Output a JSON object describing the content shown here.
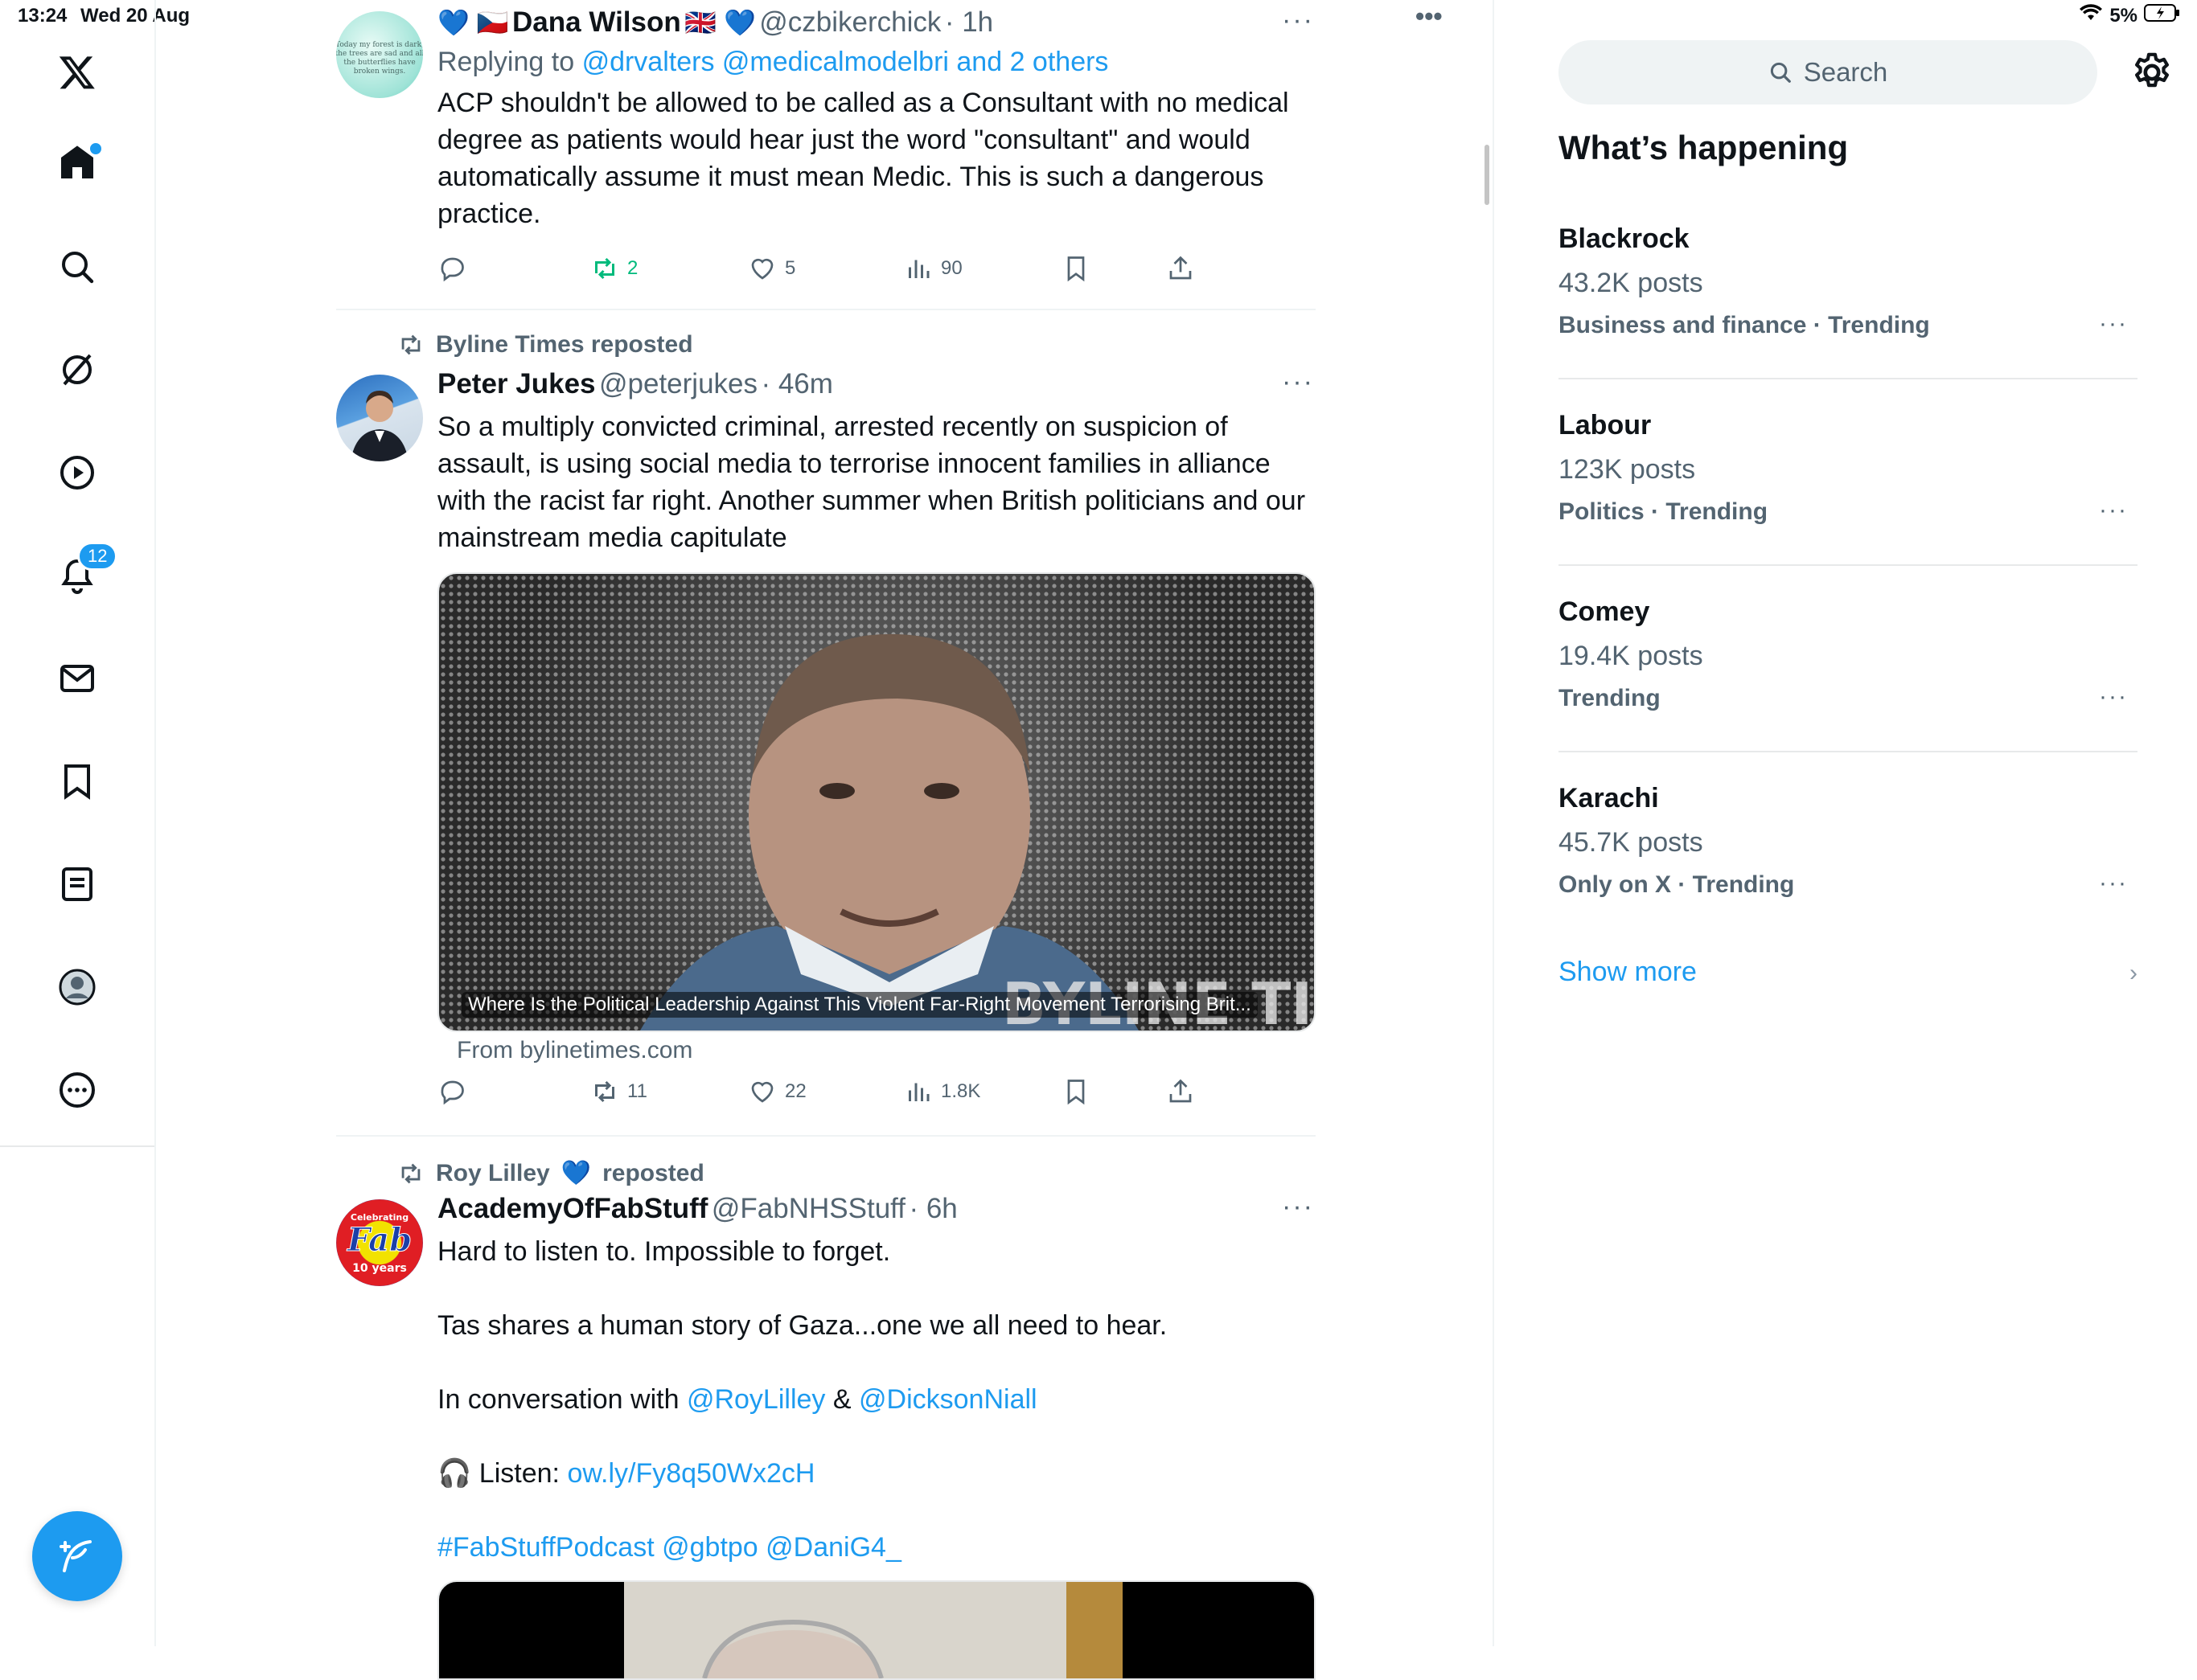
{
  "status_bar": {
    "time": "13:24",
    "date": "Wed 20 Aug",
    "battery": "5%"
  },
  "nav": {
    "notifications_badge": "12"
  },
  "feed": {
    "tweet1": {
      "name_prefix_emoji": "💙 🇨🇿",
      "name": "Dana Wilson",
      "name_suffix_emoji": "🇬🇧 💙",
      "handle": "@czbikerchick",
      "time": "· 1h",
      "top_more": "•••",
      "more": "···",
      "replying_to_label": "Replying to",
      "replying_to_users": "@drvalters @medicalmodelbri and 2 others",
      "text": "ACP shouldn't be allowed to be called as a Consultant with no medical degree as patients would hear just the word \"consultant\" and would automatically assume it must mean Medic. This is such a dangerous practice.",
      "reposts": "2",
      "likes": "5",
      "views": "90"
    },
    "tweet2": {
      "repost_by": "Byline Times reposted",
      "name": "Peter Jukes",
      "handle": "@peterjukes",
      "time": "· 46m",
      "more": "···",
      "text": "So a multiply convicted criminal, arrested recently on suspicion of assault, is using social media to terrorise innocent families in alliance with the racist far right. Another summer when British politicians and our mainstream media capitulate",
      "card_caption": "Where Is the Political Leadership Against This Violent Far-Right Movement Terrorising Brit...",
      "card_source": "From bylinetimes.com",
      "reposts": "11",
      "likes": "22",
      "views": "1.8K"
    },
    "tweet3": {
      "repost_by_name": "Roy Lilley",
      "repost_by_emoji": "💙",
      "repost_by_suffix": "reposted",
      "name": "AcademyOfFabStuff",
      "handle": "@FabNHSStuff",
      "time": "· 6h",
      "more": "···",
      "line1": "Hard to listen to. Impossible to forget.",
      "line2": "Tas shares a human story of Gaza...one we all need to hear.",
      "line3_prefix": "In conversation with",
      "line3_user1": "@RoyLilley",
      "line3_amp": "&",
      "line3_user2": "@DicksonNiall",
      "line4_emoji": "🎧",
      "line4_label": "Listen:",
      "line4_link": "ow.ly/Fy8q50Wx2cH",
      "line5": "#FabStuffPodcast @gbtpo @DaniG4_"
    }
  },
  "sidebar": {
    "search_placeholder": "Search",
    "title": "What’s happening",
    "trends": [
      {
        "name": "Blackrock",
        "posts": "43.2K posts",
        "category": "Business and finance · Trending"
      },
      {
        "name": "Labour",
        "posts": "123K posts",
        "category": "Politics · Trending"
      },
      {
        "name": "Comey",
        "posts": "19.4K posts",
        "category": "Trending"
      },
      {
        "name": "Karachi",
        "posts": "45.7K posts",
        "category": "Only on X · Trending"
      }
    ],
    "trend_more": "···",
    "show_more": "Show more",
    "show_more_chevron": "›"
  },
  "colors": {
    "accent": "#1d9bf0",
    "repost_active": "#00ba7c",
    "muted": "#536471"
  }
}
